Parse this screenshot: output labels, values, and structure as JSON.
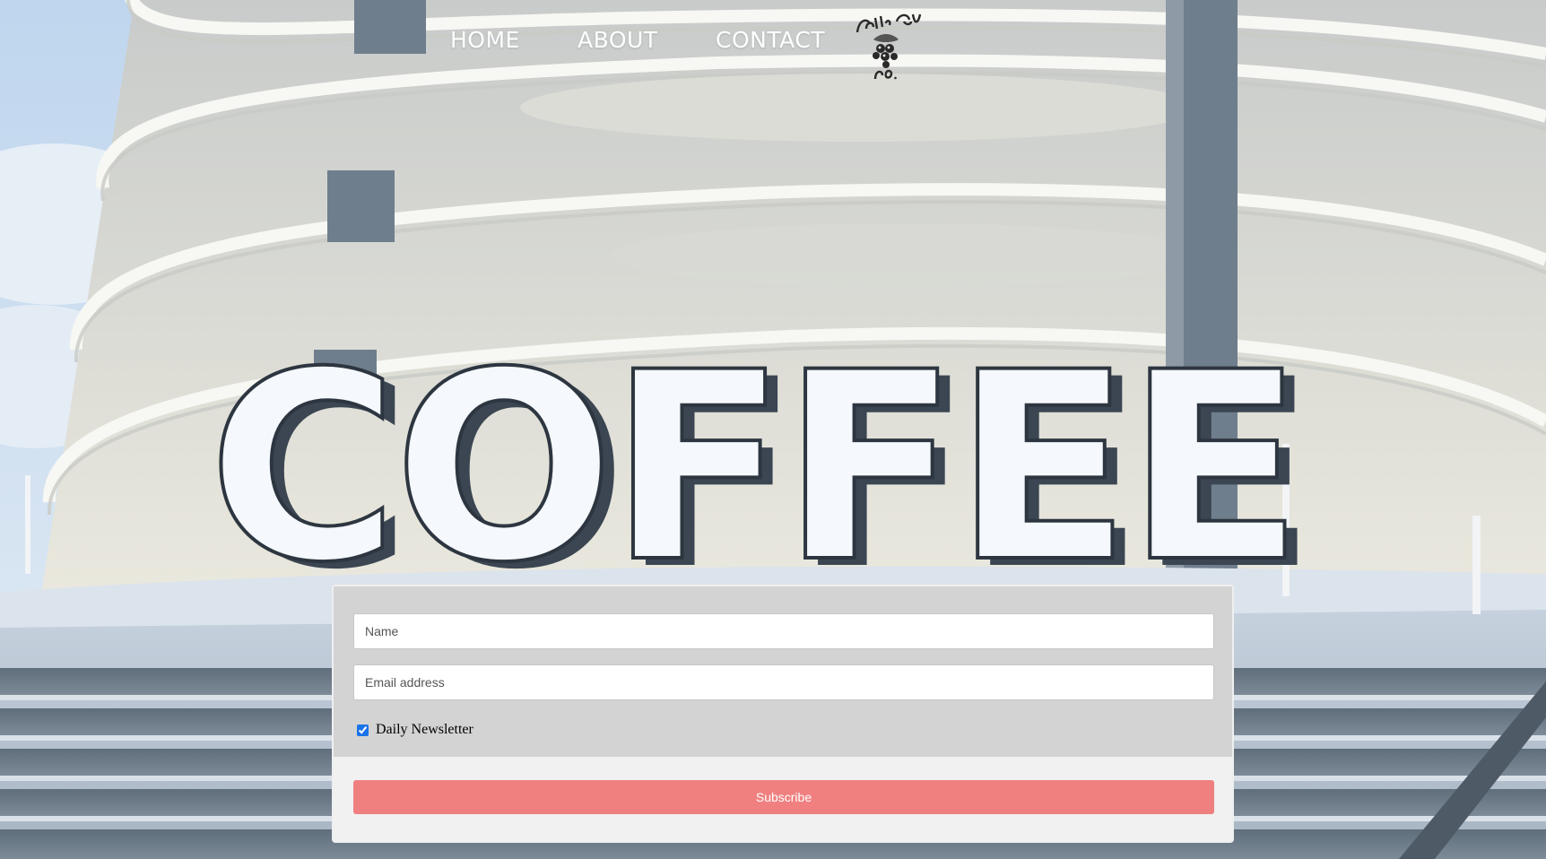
{
  "nav": {
    "home": "HOME",
    "about": "ABOUT",
    "contact": "CONTACT",
    "logo_icon": "coffee-crew-logo-icon"
  },
  "hero": {
    "sign_text": "COFFEE"
  },
  "form": {
    "name_placeholder": "Name",
    "email_placeholder": "Email address",
    "newsletter_label": "Daily Newsletter",
    "newsletter_checked": true,
    "subscribe_label": "Subscribe"
  },
  "colors": {
    "card_top": "#d3d3d3",
    "card_bottom": "#f1f1f1",
    "subscribe_button": "#f08080",
    "nav_text": "#ffffff"
  }
}
